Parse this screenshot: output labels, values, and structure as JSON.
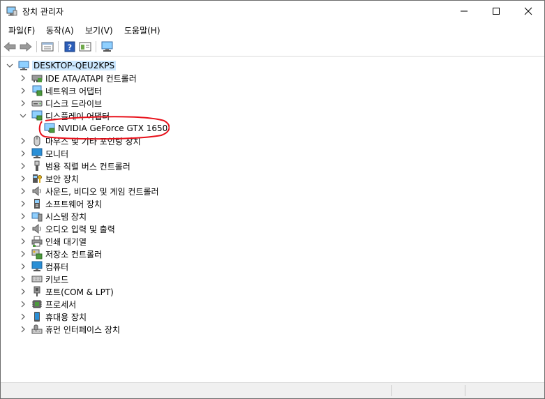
{
  "window": {
    "title": "장치 관리자",
    "minimize_glyph": "—",
    "maximize_glyph": "☐",
    "close_glyph": "✕"
  },
  "menu": [
    {
      "label": "파일(F)"
    },
    {
      "label": "동작(A)"
    },
    {
      "label": "보기(V)"
    },
    {
      "label": "도움말(H)"
    }
  ],
  "toolbar": {
    "icons": [
      "back-arrow-icon",
      "forward-arrow-icon",
      "properties-icon",
      "help-icon",
      "view-icon",
      "monitor-scan-icon"
    ]
  },
  "tree": {
    "root": {
      "label": "DESKTOP-QEU2KPS",
      "expanded": true
    },
    "categories": [
      {
        "label": "IDE ATA/ATAPI 컨트롤러",
        "icon": "ide-controller-icon",
        "expanded": false
      },
      {
        "label": "네트워크 어댑터",
        "icon": "network-adapter-icon",
        "expanded": false
      },
      {
        "label": "디스크 드라이브",
        "icon": "disk-drive-icon",
        "expanded": false
      },
      {
        "label": "디스플레이 어댑터",
        "icon": "display-adapter-icon",
        "expanded": true,
        "children": [
          {
            "label": "NVIDIA GeForce GTX 1650",
            "icon": "display-adapter-icon"
          }
        ]
      },
      {
        "label": "마우스 및 기타 포인팅 장치",
        "icon": "mouse-icon",
        "expanded": false
      },
      {
        "label": "모니터",
        "icon": "monitor-icon",
        "expanded": false
      },
      {
        "label": "범용 직렬 버스 컨트롤러",
        "icon": "usb-icon",
        "expanded": false
      },
      {
        "label": "보안 장치",
        "icon": "security-device-icon",
        "expanded": false
      },
      {
        "label": "사운드, 비디오 및 게임 컨트롤러",
        "icon": "speaker-icon",
        "expanded": false
      },
      {
        "label": "소프트웨어 장치",
        "icon": "software-device-icon",
        "expanded": false
      },
      {
        "label": "시스템 장치",
        "icon": "system-device-icon",
        "expanded": false
      },
      {
        "label": "오디오 입력 및 출력",
        "icon": "speaker-icon",
        "expanded": false
      },
      {
        "label": "인쇄 대기열",
        "icon": "printer-icon",
        "expanded": false
      },
      {
        "label": "저장소 컨트롤러",
        "icon": "storage-controller-icon",
        "expanded": false
      },
      {
        "label": "컴퓨터",
        "icon": "computer-icon",
        "expanded": false
      },
      {
        "label": "키보드",
        "icon": "keyboard-icon",
        "expanded": false
      },
      {
        "label": "포트(COM & LPT)",
        "icon": "port-icon",
        "expanded": false
      },
      {
        "label": "프로세서",
        "icon": "processor-icon",
        "expanded": false
      },
      {
        "label": "휴대용 장치",
        "icon": "portable-device-icon",
        "expanded": false
      },
      {
        "label": "휴먼 인터페이스 장치",
        "icon": "hid-icon",
        "expanded": false
      }
    ]
  },
  "colors": {
    "selection": "#cce8ff",
    "annotation": "#e8101a",
    "monitor": "#2a8fd6"
  }
}
